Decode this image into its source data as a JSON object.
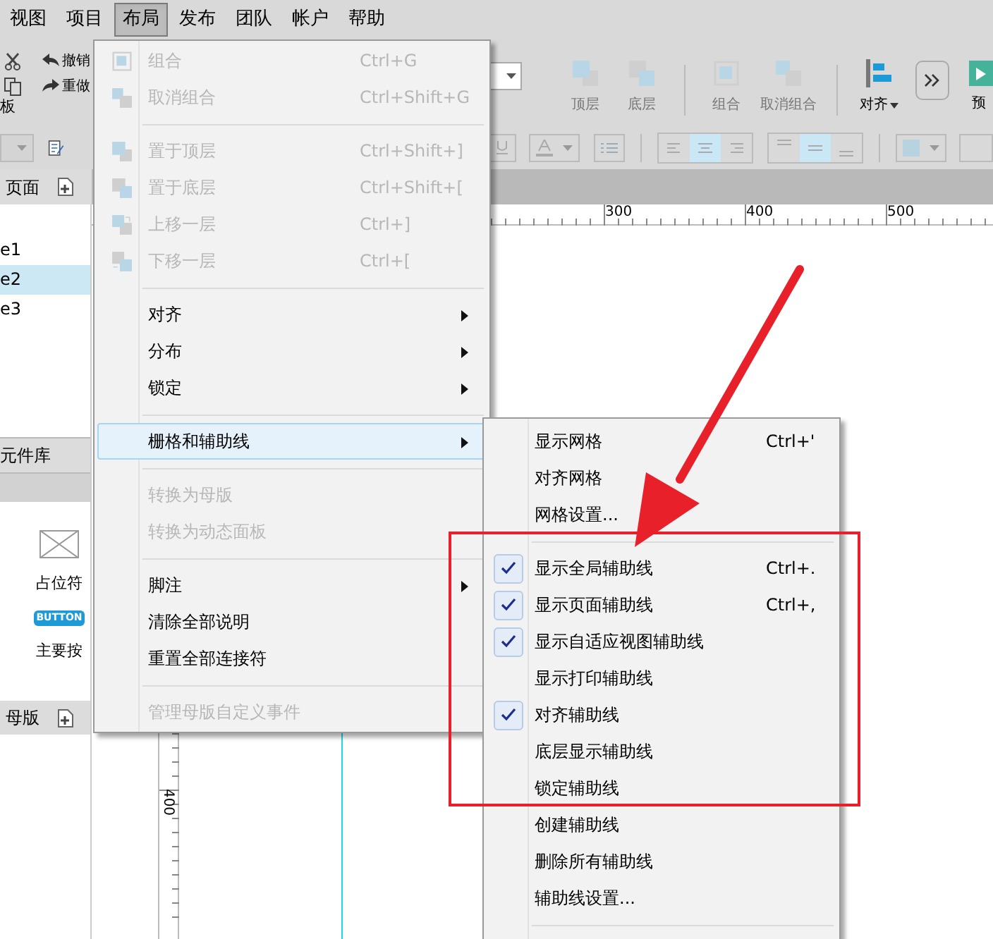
{
  "menubar": [
    {
      "label": "视图",
      "selected": false
    },
    {
      "label": "项目",
      "selected": false
    },
    {
      "label": "布局",
      "selected": true
    },
    {
      "label": "发布",
      "selected": false
    },
    {
      "label": "团队",
      "selected": false
    },
    {
      "label": "帐户",
      "selected": false
    },
    {
      "label": "帮助",
      "selected": false
    }
  ],
  "toolbar": {
    "undo": "撤销",
    "redo": "重做",
    "clipboard_label": "板",
    "buttons": [
      {
        "label": "顶层",
        "disabled": true
      },
      {
        "label": "底层",
        "disabled": true
      },
      {
        "label": "组合",
        "disabled": true
      },
      {
        "label": "取消组合",
        "disabled": true
      },
      {
        "label": "对齐",
        "disabled": false
      }
    ],
    "preview_label": "预"
  },
  "format_bar": {
    "text_align": [
      {
        "selected": false
      },
      {
        "selected": true
      },
      {
        "selected": false
      }
    ],
    "vertical_align": [
      {
        "selected": false
      },
      {
        "selected": true
      },
      {
        "selected": false
      }
    ]
  },
  "pages_panel": {
    "title": "页面",
    "pages": [
      {
        "label": "e1",
        "selected": false
      },
      {
        "label": "e2",
        "selected": true
      },
      {
        "label": "e3",
        "selected": false
      }
    ]
  },
  "library_panel": {
    "title": "元件库",
    "widgets": [
      {
        "kind": "placeholder",
        "label": "占位符"
      },
      {
        "kind": "button",
        "icon_text": "BUTTON",
        "label": "主要按"
      }
    ]
  },
  "masters_panel": {
    "title": "母版"
  },
  "ruler": {
    "x_labels": [
      "300",
      "400",
      "500"
    ],
    "y_labels": [
      "400"
    ]
  },
  "layout_menu": {
    "items": [
      {
        "kind": "item",
        "label": "组合",
        "shortcut": "Ctrl+G",
        "disabled": true,
        "submenu": false,
        "highlighted": false
      },
      {
        "kind": "item",
        "label": "取消组合",
        "shortcut": "Ctrl+Shift+G",
        "disabled": true,
        "submenu": false,
        "highlighted": false
      },
      {
        "kind": "separator"
      },
      {
        "kind": "item",
        "label": "置于顶层",
        "shortcut": "Ctrl+Shift+]",
        "disabled": true,
        "submenu": false,
        "highlighted": false
      },
      {
        "kind": "item",
        "label": "置于底层",
        "shortcut": "Ctrl+Shift+[",
        "disabled": true,
        "submenu": false,
        "highlighted": false
      },
      {
        "kind": "item",
        "label": "上移一层",
        "shortcut": "Ctrl+]",
        "disabled": true,
        "submenu": false,
        "highlighted": false
      },
      {
        "kind": "item",
        "label": "下移一层",
        "shortcut": "Ctrl+[",
        "disabled": true,
        "submenu": false,
        "highlighted": false
      },
      {
        "kind": "separator"
      },
      {
        "kind": "item",
        "label": "对齐",
        "disabled": false,
        "submenu": true,
        "highlighted": false
      },
      {
        "kind": "item",
        "label": "分布",
        "disabled": false,
        "submenu": true,
        "highlighted": false
      },
      {
        "kind": "item",
        "label": "锁定",
        "disabled": false,
        "submenu": true,
        "highlighted": false
      },
      {
        "kind": "separator"
      },
      {
        "kind": "item",
        "label": "栅格和辅助线",
        "disabled": false,
        "submenu": true,
        "highlighted": true
      },
      {
        "kind": "separator"
      },
      {
        "kind": "item",
        "label": "转换为母版",
        "disabled": true,
        "submenu": false,
        "highlighted": false
      },
      {
        "kind": "item",
        "label": "转换为动态面板",
        "disabled": true,
        "submenu": false,
        "highlighted": false
      },
      {
        "kind": "separator"
      },
      {
        "kind": "item",
        "label": "脚注",
        "disabled": false,
        "submenu": true,
        "highlighted": false
      },
      {
        "kind": "item",
        "label": "清除全部说明",
        "disabled": false,
        "submenu": false,
        "highlighted": false
      },
      {
        "kind": "item",
        "label": "重置全部连接符",
        "disabled": false,
        "submenu": false,
        "highlighted": false
      },
      {
        "kind": "separator"
      },
      {
        "kind": "item",
        "label": "管理母版自定义事件",
        "disabled": true,
        "submenu": false,
        "highlighted": false
      }
    ]
  },
  "grid_submenu": {
    "items": [
      {
        "kind": "item",
        "label": "显示网格",
        "shortcut": "Ctrl+'",
        "checked": false
      },
      {
        "kind": "item",
        "label": "对齐网格",
        "checked": false
      },
      {
        "kind": "item",
        "label": "网格设置...",
        "checked": false
      },
      {
        "kind": "separator"
      },
      {
        "kind": "item",
        "label": "显示全局辅助线",
        "shortcut": "Ctrl+.",
        "checked": true
      },
      {
        "kind": "item",
        "label": "显示页面辅助线",
        "shortcut": "Ctrl+,",
        "checked": true
      },
      {
        "kind": "item",
        "label": "显示自适应视图辅助线",
        "checked": true
      },
      {
        "kind": "item",
        "label": "显示打印辅助线",
        "checked": false
      },
      {
        "kind": "item",
        "label": "对齐辅助线",
        "checked": true
      },
      {
        "kind": "item",
        "label": "底层显示辅助线",
        "checked": false
      },
      {
        "kind": "item",
        "label": "锁定辅助线",
        "checked": false
      },
      {
        "kind": "item",
        "label": "创建辅助线",
        "checked": false
      },
      {
        "kind": "item",
        "label": "删除所有辅助线",
        "checked": false
      },
      {
        "kind": "item",
        "label": "辅助线设置...",
        "checked": false
      },
      {
        "kind": "separator"
      }
    ]
  }
}
